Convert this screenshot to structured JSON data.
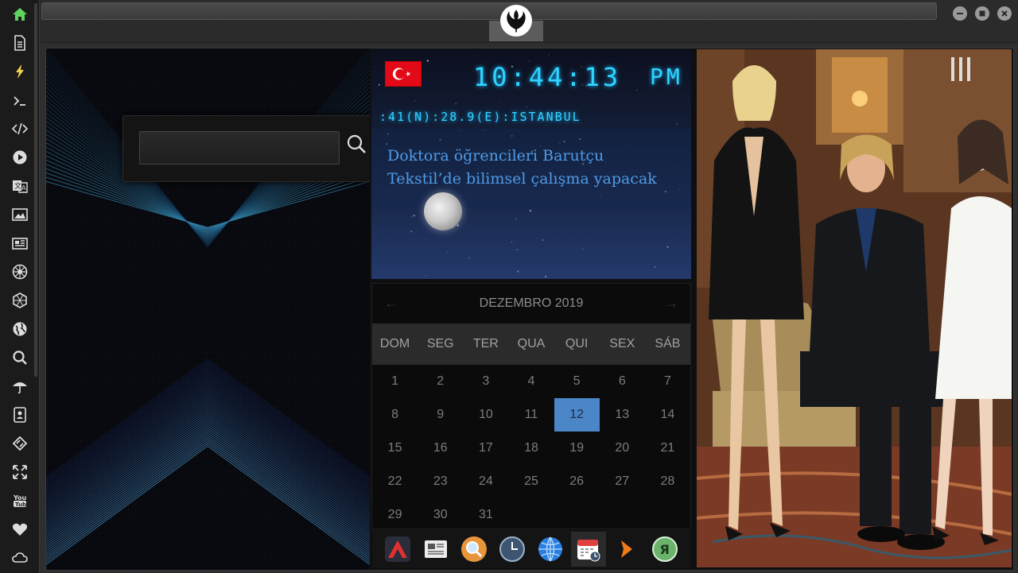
{
  "sidebar": {
    "items": [
      {
        "icon": "home-icon",
        "active": true
      },
      {
        "icon": "document-icon"
      },
      {
        "icon": "lightning-icon"
      },
      {
        "icon": "terminal-icon"
      },
      {
        "icon": "code-icon"
      },
      {
        "icon": "play-icon"
      },
      {
        "icon": "translate-icon"
      },
      {
        "icon": "image-icon"
      },
      {
        "icon": "news-icon"
      },
      {
        "icon": "empire-icon"
      },
      {
        "icon": "hexagon-icon"
      },
      {
        "icon": "globe-icon"
      },
      {
        "icon": "search-icon"
      },
      {
        "icon": "umbrella-icon"
      },
      {
        "icon": "contacts-icon"
      },
      {
        "icon": "tag-icon"
      },
      {
        "icon": "fullscreen-icon"
      },
      {
        "icon": "youtube-icon"
      },
      {
        "icon": "heart-icon"
      },
      {
        "icon": "cloud-icon"
      }
    ],
    "accent_color": "#5fd35f"
  },
  "window": {
    "logo_icon": "rebel-alliance-icon",
    "buttons": [
      "minimize",
      "maximize",
      "close"
    ]
  },
  "search": {
    "value": "",
    "placeholder": ""
  },
  "clock": {
    "time": "10:44:13",
    "ampm": "PM",
    "location": ":41(N):28.9(E):ISTANBUL",
    "flag_icon": "turkey-flag-icon",
    "news": "Doktora öğrencileri Barutçu Tekstil’de bilimsel çalışma yapacak"
  },
  "calendar": {
    "month_label": "DEZEMBRO 2019",
    "weekdays": [
      "DOM",
      "SEG",
      "TER",
      "QUA",
      "QUI",
      "SEX",
      "SÁB"
    ],
    "days": [
      "1",
      "2",
      "3",
      "4",
      "5",
      "6",
      "7",
      "8",
      "9",
      "10",
      "11",
      "12",
      "13",
      "14",
      "15",
      "16",
      "17",
      "18",
      "19",
      "20",
      "21",
      "22",
      "23",
      "24",
      "25",
      "26",
      "27",
      "28",
      "29",
      "30",
      "31"
    ],
    "today": "12",
    "today_color": "#4a86c8"
  },
  "dock": {
    "items": [
      {
        "icon": "arrow-app-icon"
      },
      {
        "icon": "newspaper-icon"
      },
      {
        "icon": "magnifier-app-icon"
      },
      {
        "icon": "clock-app-icon"
      },
      {
        "icon": "globe-app-icon"
      },
      {
        "icon": "calendar-app-icon",
        "active": true
      },
      {
        "icon": "chevron-app-icon"
      },
      {
        "icon": "yandex-icon"
      }
    ]
  },
  "photo": {
    "subject": "photo-panel"
  }
}
